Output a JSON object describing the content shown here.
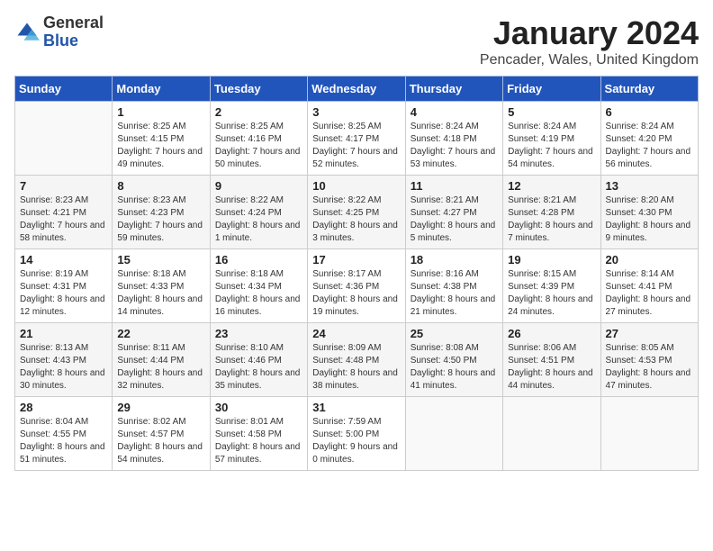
{
  "header": {
    "logo_general": "General",
    "logo_blue": "Blue",
    "title": "January 2024",
    "location": "Pencader, Wales, United Kingdom"
  },
  "days_of_week": [
    "Sunday",
    "Monday",
    "Tuesday",
    "Wednesday",
    "Thursday",
    "Friday",
    "Saturday"
  ],
  "weeks": [
    [
      {
        "day": "",
        "sunrise": "",
        "sunset": "",
        "daylight": ""
      },
      {
        "day": "1",
        "sunrise": "Sunrise: 8:25 AM",
        "sunset": "Sunset: 4:15 PM",
        "daylight": "Daylight: 7 hours and 49 minutes."
      },
      {
        "day": "2",
        "sunrise": "Sunrise: 8:25 AM",
        "sunset": "Sunset: 4:16 PM",
        "daylight": "Daylight: 7 hours and 50 minutes."
      },
      {
        "day": "3",
        "sunrise": "Sunrise: 8:25 AM",
        "sunset": "Sunset: 4:17 PM",
        "daylight": "Daylight: 7 hours and 52 minutes."
      },
      {
        "day": "4",
        "sunrise": "Sunrise: 8:24 AM",
        "sunset": "Sunset: 4:18 PM",
        "daylight": "Daylight: 7 hours and 53 minutes."
      },
      {
        "day": "5",
        "sunrise": "Sunrise: 8:24 AM",
        "sunset": "Sunset: 4:19 PM",
        "daylight": "Daylight: 7 hours and 54 minutes."
      },
      {
        "day": "6",
        "sunrise": "Sunrise: 8:24 AM",
        "sunset": "Sunset: 4:20 PM",
        "daylight": "Daylight: 7 hours and 56 minutes."
      }
    ],
    [
      {
        "day": "7",
        "sunrise": "Sunrise: 8:23 AM",
        "sunset": "Sunset: 4:21 PM",
        "daylight": "Daylight: 7 hours and 58 minutes."
      },
      {
        "day": "8",
        "sunrise": "Sunrise: 8:23 AM",
        "sunset": "Sunset: 4:23 PM",
        "daylight": "Daylight: 7 hours and 59 minutes."
      },
      {
        "day": "9",
        "sunrise": "Sunrise: 8:22 AM",
        "sunset": "Sunset: 4:24 PM",
        "daylight": "Daylight: 8 hours and 1 minute."
      },
      {
        "day": "10",
        "sunrise": "Sunrise: 8:22 AM",
        "sunset": "Sunset: 4:25 PM",
        "daylight": "Daylight: 8 hours and 3 minutes."
      },
      {
        "day": "11",
        "sunrise": "Sunrise: 8:21 AM",
        "sunset": "Sunset: 4:27 PM",
        "daylight": "Daylight: 8 hours and 5 minutes."
      },
      {
        "day": "12",
        "sunrise": "Sunrise: 8:21 AM",
        "sunset": "Sunset: 4:28 PM",
        "daylight": "Daylight: 8 hours and 7 minutes."
      },
      {
        "day": "13",
        "sunrise": "Sunrise: 8:20 AM",
        "sunset": "Sunset: 4:30 PM",
        "daylight": "Daylight: 8 hours and 9 minutes."
      }
    ],
    [
      {
        "day": "14",
        "sunrise": "Sunrise: 8:19 AM",
        "sunset": "Sunset: 4:31 PM",
        "daylight": "Daylight: 8 hours and 12 minutes."
      },
      {
        "day": "15",
        "sunrise": "Sunrise: 8:18 AM",
        "sunset": "Sunset: 4:33 PM",
        "daylight": "Daylight: 8 hours and 14 minutes."
      },
      {
        "day": "16",
        "sunrise": "Sunrise: 8:18 AM",
        "sunset": "Sunset: 4:34 PM",
        "daylight": "Daylight: 8 hours and 16 minutes."
      },
      {
        "day": "17",
        "sunrise": "Sunrise: 8:17 AM",
        "sunset": "Sunset: 4:36 PM",
        "daylight": "Daylight: 8 hours and 19 minutes."
      },
      {
        "day": "18",
        "sunrise": "Sunrise: 8:16 AM",
        "sunset": "Sunset: 4:38 PM",
        "daylight": "Daylight: 8 hours and 21 minutes."
      },
      {
        "day": "19",
        "sunrise": "Sunrise: 8:15 AM",
        "sunset": "Sunset: 4:39 PM",
        "daylight": "Daylight: 8 hours and 24 minutes."
      },
      {
        "day": "20",
        "sunrise": "Sunrise: 8:14 AM",
        "sunset": "Sunset: 4:41 PM",
        "daylight": "Daylight: 8 hours and 27 minutes."
      }
    ],
    [
      {
        "day": "21",
        "sunrise": "Sunrise: 8:13 AM",
        "sunset": "Sunset: 4:43 PM",
        "daylight": "Daylight: 8 hours and 30 minutes."
      },
      {
        "day": "22",
        "sunrise": "Sunrise: 8:11 AM",
        "sunset": "Sunset: 4:44 PM",
        "daylight": "Daylight: 8 hours and 32 minutes."
      },
      {
        "day": "23",
        "sunrise": "Sunrise: 8:10 AM",
        "sunset": "Sunset: 4:46 PM",
        "daylight": "Daylight: 8 hours and 35 minutes."
      },
      {
        "day": "24",
        "sunrise": "Sunrise: 8:09 AM",
        "sunset": "Sunset: 4:48 PM",
        "daylight": "Daylight: 8 hours and 38 minutes."
      },
      {
        "day": "25",
        "sunrise": "Sunrise: 8:08 AM",
        "sunset": "Sunset: 4:50 PM",
        "daylight": "Daylight: 8 hours and 41 minutes."
      },
      {
        "day": "26",
        "sunrise": "Sunrise: 8:06 AM",
        "sunset": "Sunset: 4:51 PM",
        "daylight": "Daylight: 8 hours and 44 minutes."
      },
      {
        "day": "27",
        "sunrise": "Sunrise: 8:05 AM",
        "sunset": "Sunset: 4:53 PM",
        "daylight": "Daylight: 8 hours and 47 minutes."
      }
    ],
    [
      {
        "day": "28",
        "sunrise": "Sunrise: 8:04 AM",
        "sunset": "Sunset: 4:55 PM",
        "daylight": "Daylight: 8 hours and 51 minutes."
      },
      {
        "day": "29",
        "sunrise": "Sunrise: 8:02 AM",
        "sunset": "Sunset: 4:57 PM",
        "daylight": "Daylight: 8 hours and 54 minutes."
      },
      {
        "day": "30",
        "sunrise": "Sunrise: 8:01 AM",
        "sunset": "Sunset: 4:58 PM",
        "daylight": "Daylight: 8 hours and 57 minutes."
      },
      {
        "day": "31",
        "sunrise": "Sunrise: 7:59 AM",
        "sunset": "Sunset: 5:00 PM",
        "daylight": "Daylight: 9 hours and 0 minutes."
      },
      {
        "day": "",
        "sunrise": "",
        "sunset": "",
        "daylight": ""
      },
      {
        "day": "",
        "sunrise": "",
        "sunset": "",
        "daylight": ""
      },
      {
        "day": "",
        "sunrise": "",
        "sunset": "",
        "daylight": ""
      }
    ]
  ]
}
